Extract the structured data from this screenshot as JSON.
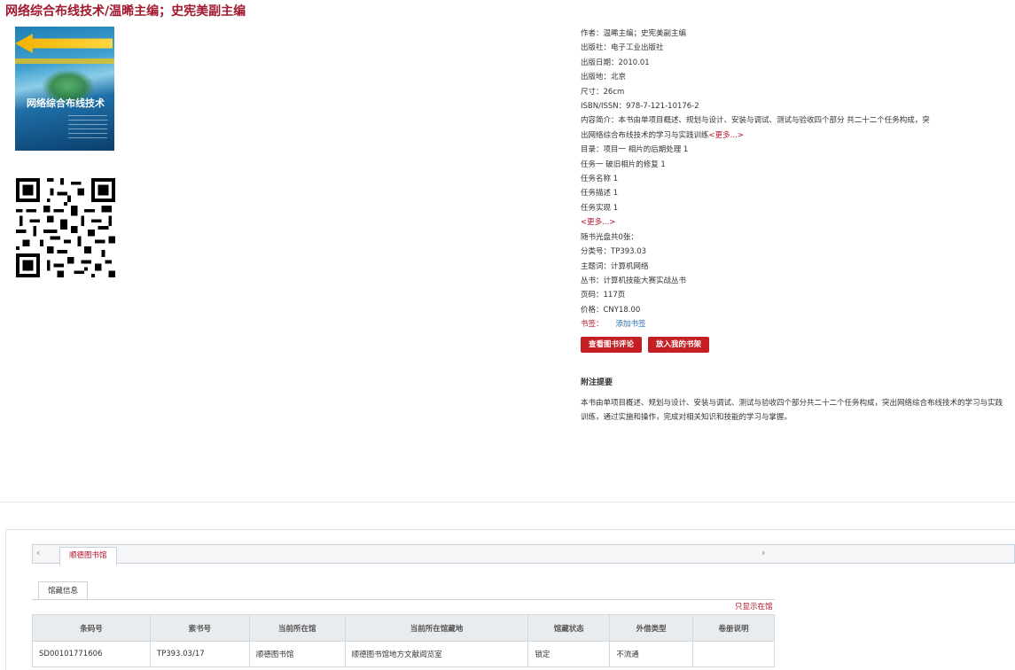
{
  "title": "网络综合布线技术/温晞主编；史宪美副主编",
  "cover": {
    "title_text": "网络综合布线技术"
  },
  "info": {
    "author": "作者：温晞主编；史宪美副主编",
    "publisher": "出版社：电子工业出版社",
    "pub_date": "出版日期：2010.01",
    "place": "出版地：北京",
    "size": "尺寸：26cm",
    "isbn": "ISBN/ISSN：978-7-121-10176-2",
    "summary": "内容简介：本书由单项目概述、规划与设计、安装与调试、测试与验收四个部分 共二十二个任务构成，突出网络综合布线技术的学习与实践训练",
    "summary_more": "<更多...>",
    "toc_lines": [
      "目录：项目一 相片的后期处理 1",
      "任务一 破旧相片的修复 1",
      "任务名称 1",
      "任务描述 1",
      "任务实现 1"
    ],
    "toc_more": "<更多...>",
    "cd": "随书光盘共0张：",
    "class_no": "分类号：TP393.03",
    "subject": "主题词：计算机网络",
    "series": "丛书：计算机技能大赛实战丛书",
    "pages": "页码：117页",
    "price": "价格：CNY18.00",
    "tags_label": "书签：",
    "tags_link": "添加书签"
  },
  "buttons": {
    "review": "查看图书评论",
    "shelf": "放入我的书架"
  },
  "notes": {
    "title": "附注提要",
    "text": "本书由单项目概述、规划与设计、安装与调试、测试与验收四个部分共二十二个任务构成，突出网络综合布线技术的学习与实践训练，通过实施和操作，完成对相关知识和技能的学习与掌握。"
  },
  "holdings": {
    "tab_prev": "‹",
    "tab_next": "›",
    "library_tab": "顺德图书馆",
    "sub_tab": "馆藏信息",
    "only_here": "只显示在馆",
    "columns": [
      "条码号",
      "索书号",
      "当前所在馆",
      "当前所在馆藏地",
      "馆藏状态",
      "外借类型",
      "卷册说明"
    ],
    "rows": [
      [
        "SD00101771606",
        "TP393.03/17",
        "顺德图书馆",
        "顺德图书馆地方文献阅览室",
        "锁定",
        "不流通",
        ""
      ]
    ]
  }
}
